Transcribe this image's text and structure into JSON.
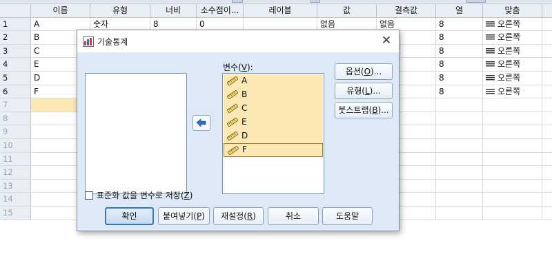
{
  "grid": {
    "columns": [
      "",
      "이름",
      "유형",
      "너비",
      "소수점이...",
      "레이블",
      "값",
      "결측값",
      "열",
      "맞춤",
      ""
    ],
    "visible_rows": [
      [
        "1",
        "A",
        "숫자",
        "8",
        "0",
        "",
        "없음",
        "없음",
        "8",
        "오른쪽"
      ],
      [
        "2",
        "B",
        "",
        "",
        "",
        "",
        "",
        "",
        "8",
        "오른쪽"
      ],
      [
        "3",
        "C",
        "",
        "",
        "",
        "",
        "",
        "",
        "8",
        "오른쪽"
      ],
      [
        "4",
        "E",
        "",
        "",
        "",
        "",
        "",
        "",
        "8",
        "오른쪽"
      ],
      [
        "5",
        "D",
        "",
        "",
        "",
        "",
        "",
        "",
        "8",
        "오른쪽"
      ],
      [
        "6",
        "F",
        "",
        "",
        "",
        "",
        "",
        "",
        "8",
        "오른쪽"
      ],
      [
        "7"
      ],
      [
        "8"
      ],
      [
        "9"
      ],
      [
        "10"
      ],
      [
        "11"
      ],
      [
        "12"
      ],
      [
        "13"
      ],
      [
        "14"
      ],
      [
        "15"
      ]
    ]
  },
  "dialog": {
    "title": "기술통계",
    "close_glyph": "✕",
    "variables_label": "변수(V):",
    "variables": [
      "A",
      "B",
      "C",
      "E",
      "D",
      "F"
    ],
    "side_buttons": [
      "옵션(O)...",
      "유형(L)...",
      "붓스트랩(B)..."
    ],
    "checkbox_label": "표준화 값을 변수로 저장(Z)",
    "checkbox_checked": false,
    "buttons": [
      "확인",
      "붙여넣기(P)",
      "재설정(R)",
      "취소",
      "도움말"
    ]
  },
  "colors": {
    "selection": "#fbe8b5",
    "dialog_bg": "#dde9f6",
    "primary_border": "#3a76b6"
  }
}
